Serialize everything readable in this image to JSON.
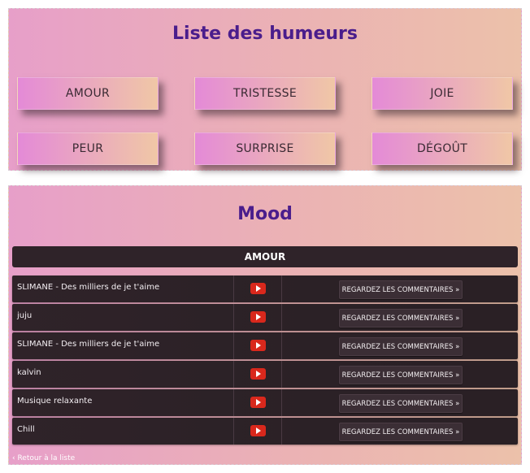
{
  "list_panel": {
    "title": "Liste des humeurs",
    "moods": [
      "AMOUR",
      "TRISTESSE",
      "JOIE",
      "PEUR",
      "SURPRISE",
      "DÉGOÛT"
    ]
  },
  "mood_panel": {
    "title": "Mood",
    "selected_mood": "AMOUR",
    "rows": [
      {
        "name": "SLIMANE - Des milliers de je t'aime",
        "action": "REGARDEZ LES COMMENTAIRES »"
      },
      {
        "name": "juju",
        "action": "REGARDEZ LES COMMENTAIRES »"
      },
      {
        "name": "SLIMANE - Des milliers de je t'aime",
        "action": "REGARDEZ LES COMMENTAIRES »"
      },
      {
        "name": "kalvin",
        "action": "REGARDEZ LES COMMENTAIRES »"
      },
      {
        "name": "Musique relaxante",
        "action": "REGARDEZ LES COMMENTAIRES »"
      },
      {
        "name": "Chill",
        "action": "REGARDEZ LES COMMENTAIRES »"
      }
    ],
    "back_link": "‹ Retour à la liste"
  },
  "colors": {
    "title": "#4a1d8c",
    "panel_gradient_start": "#e79fc9",
    "panel_gradient_end": "#ecc1aa",
    "row_bg": "#2f2329",
    "youtube_red": "#d9281c"
  },
  "icons": [
    "youtube-icon"
  ]
}
